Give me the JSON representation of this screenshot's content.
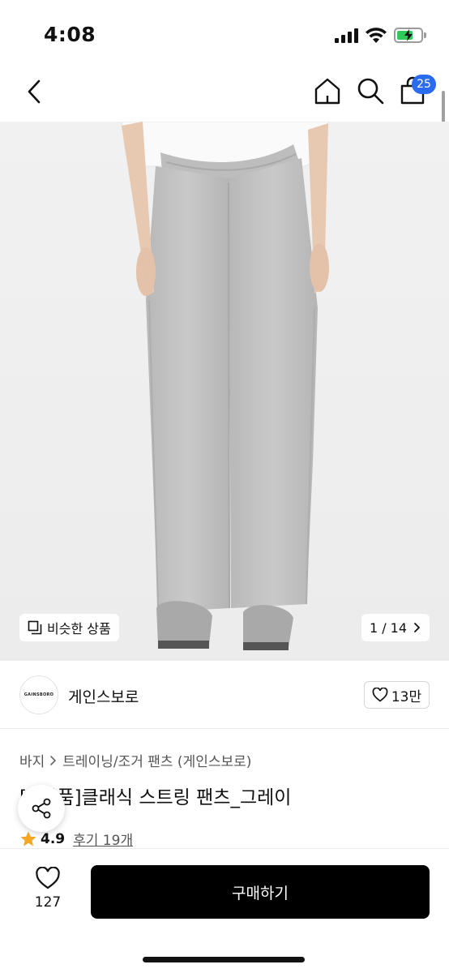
{
  "status_bar": {
    "time": "4:08"
  },
  "nav": {
    "cart_count": "25",
    "icons": [
      "back-arrow-icon",
      "home-icon",
      "search-icon",
      "shopping-bag-icon"
    ]
  },
  "gallery": {
    "similar_label": "비슷한 상품",
    "page_indicator": "1 / 14"
  },
  "brand": {
    "logo_text": "GAINSBORO",
    "name": "게인스보로",
    "like_count": "13만"
  },
  "breadcrumb": {
    "category": "바지",
    "subcategory": "트레이닝/조거 팬츠 (게인스보로)"
  },
  "product": {
    "title": "[  ]반품]클래식 스트링 팬츠_그레이",
    "rating": "4.9",
    "review_label": "후기 19개"
  },
  "bottom_bar": {
    "like_count": "127",
    "buy_label": "구매하기"
  },
  "colors": {
    "accent_badge": "#2b6bf0",
    "buy_button": "#000000",
    "star": "#f5a623",
    "battery": "#34c759"
  }
}
